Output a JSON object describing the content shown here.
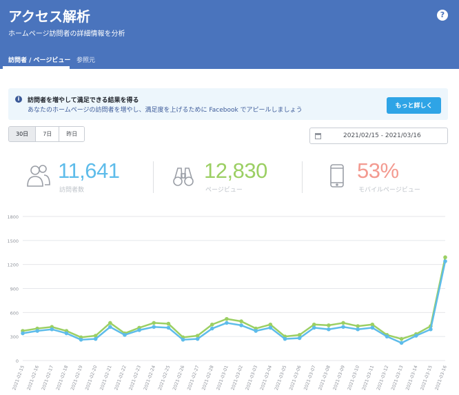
{
  "header": {
    "title": "アクセス解析",
    "subtitle": "ホームページ訪問者の詳細情報を分析",
    "help": "?",
    "tabs": [
      {
        "label": "訪問者 / ページビュー",
        "active": true
      },
      {
        "label": "参照元",
        "active": false
      }
    ]
  },
  "banner": {
    "icon": "info-icon",
    "title": "訪問者を増やして満足できる結果を得る",
    "text": "あなたのホームページの訪問者を増やし、満足度を上げるために Facebook でアピールしましょう",
    "button": "もっと詳しく"
  },
  "range": {
    "options": [
      "30日",
      "7日",
      "昨日"
    ],
    "selected": "30日"
  },
  "date_range": "2021/02/15 - 2021/03/16",
  "stats": [
    {
      "icon": "visitors-icon",
      "value": "11,641",
      "label": "訪問者数",
      "color": "#5ebcea"
    },
    {
      "icon": "binoculars-icon",
      "value": "12,830",
      "label": "ページビュー",
      "color": "#9bcf63"
    },
    {
      "icon": "mobile-icon",
      "value": "53%",
      "label": "モバイルページビュー",
      "color": "#f39a90"
    }
  ],
  "chart_data": {
    "type": "line",
    "ylim": [
      0,
      1800
    ],
    "yticks": [
      "0",
      "300",
      "600",
      "900",
      "1200",
      "1500",
      "1800"
    ],
    "x": [
      "2021-02-15",
      "2021-02-16",
      "2021-02-17",
      "2021-02-18",
      "2021-02-19",
      "2021-02-20",
      "2021-02-21",
      "2021-02-22",
      "2021-02-23",
      "2021-02-24",
      "2021-02-25",
      "2021-02-26",
      "2021-02-27",
      "2021-02-28",
      "2021-03-01",
      "2021-03-02",
      "2021-03-03",
      "2021-03-04",
      "2021-03-05",
      "2021-03-06",
      "2021-03-07",
      "2021-03-08",
      "2021-03-09",
      "2021-03-10",
      "2021-03-11",
      "2021-03-12",
      "2021-03-13",
      "2021-03-14",
      "2021-03-15",
      "2021-03-16"
    ],
    "series": [
      {
        "key": "pageviews",
        "color": "#9bcf63",
        "values": [
          370,
          400,
          420,
          370,
          290,
          310,
          470,
          340,
          410,
          470,
          460,
          290,
          310,
          450,
          520,
          490,
          400,
          450,
          300,
          320,
          450,
          440,
          470,
          430,
          450,
          320,
          270,
          330,
          430,
          1290
        ]
      },
      {
        "key": "visitors",
        "color": "#5ebcea",
        "values": [
          340,
          370,
          390,
          340,
          260,
          270,
          420,
          320,
          380,
          420,
          410,
          260,
          270,
          400,
          470,
          440,
          370,
          410,
          270,
          280,
          410,
          390,
          420,
          390,
          410,
          300,
          220,
          310,
          390,
          1240
        ]
      }
    ],
    "grid": true
  }
}
